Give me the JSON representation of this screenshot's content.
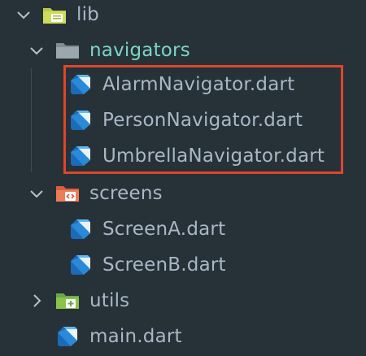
{
  "colors": {
    "background": "#263238",
    "text": "#a9b7c6",
    "accent_text": "#7fd3c7",
    "highlight_border": "#e0452b"
  },
  "tree": {
    "lib": {
      "label": "lib",
      "icon": "library-folder-icon",
      "expanded": true
    },
    "navigators": {
      "label": "navigators",
      "icon": "folder-icon",
      "expanded": true,
      "files": [
        {
          "label": "AlarmNavigator.dart",
          "icon": "dart-file-icon"
        },
        {
          "label": "PersonNavigator.dart",
          "icon": "dart-file-icon"
        },
        {
          "label": "UmbrellaNavigator.dart",
          "icon": "dart-file-icon"
        }
      ]
    },
    "screens": {
      "label": "screens",
      "icon": "screens-folder-icon",
      "expanded": true,
      "files": [
        {
          "label": "ScreenA.dart",
          "icon": "dart-file-icon"
        },
        {
          "label": "ScreenB.dart",
          "icon": "dart-file-icon"
        }
      ]
    },
    "utils": {
      "label": "utils",
      "icon": "utils-folder-icon",
      "expanded": false
    },
    "main": {
      "label": "main.dart",
      "icon": "dart-file-icon"
    }
  }
}
